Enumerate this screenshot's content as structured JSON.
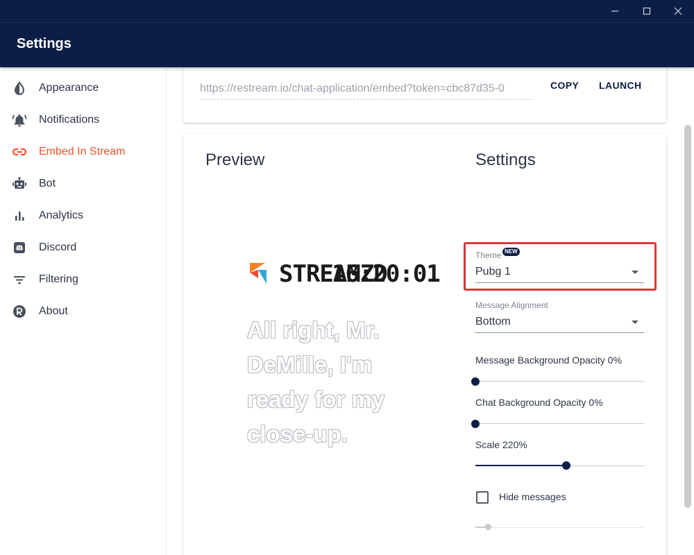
{
  "window": {
    "controls": [
      {
        "name": "minimize-icon"
      },
      {
        "name": "maximize-icon"
      },
      {
        "name": "close-icon"
      }
    ]
  },
  "header": {
    "title": "Settings"
  },
  "sidebar": {
    "items": [
      {
        "label": "Appearance",
        "icon": "drop-icon",
        "active": false
      },
      {
        "label": "Notifications",
        "icon": "bell-icon",
        "active": false
      },
      {
        "label": "Embed In Stream",
        "icon": "link-icon",
        "active": true
      },
      {
        "label": "Bot",
        "icon": "robot-icon",
        "active": false
      },
      {
        "label": "Analytics",
        "icon": "bar-chart-icon",
        "active": false
      },
      {
        "label": "Discord",
        "icon": "discord-icon",
        "active": false
      },
      {
        "label": "Filtering",
        "icon": "filter-icon",
        "active": false
      },
      {
        "label": "About",
        "icon": "restream-logo-icon",
        "active": false
      }
    ],
    "active_color": "#f0512a"
  },
  "embed": {
    "url": "https://restream.io/chat-application/embed?token=cbc87d35-0",
    "copy_label": "COPY",
    "launch_label": "LAUNCH"
  },
  "preview": {
    "title": "Preview",
    "brand": "STREAMZD",
    "clock": "16:20:01",
    "message": "All right, Mr. DeMille, I'm ready for my close-up."
  },
  "settings": {
    "title": "Settings",
    "theme": {
      "label": "Theme",
      "badge": "NEW",
      "value": "Pubg 1"
    },
    "alignment": {
      "label": "Message Alignment",
      "value": "Bottom"
    },
    "message_bg_opacity": {
      "label": "Message Background Opacity 0%",
      "value_percent": 0
    },
    "chat_bg_opacity": {
      "label": "Chat Background Opacity 0%",
      "value_percent": 0
    },
    "scale": {
      "label": "Scale 220%",
      "value_percent": 220,
      "fraction": 0.54
    },
    "hide_messages": {
      "label": "Hide messages",
      "checked": false,
      "fraction": 0.07
    }
  },
  "colors": {
    "header_bg": "#0c1e45",
    "accent": "#f0512a",
    "highlight": "#d9373a"
  }
}
